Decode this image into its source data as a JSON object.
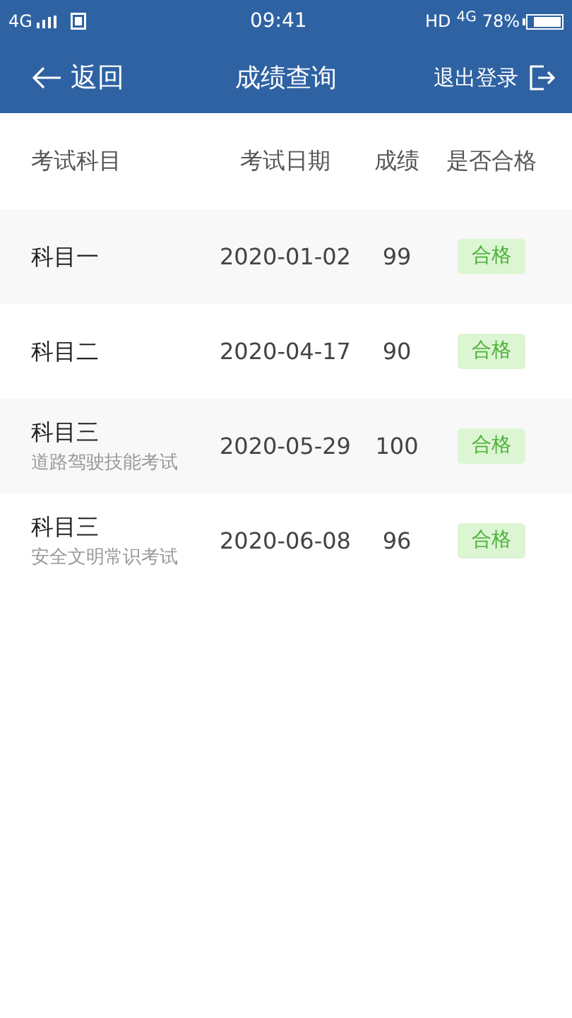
{
  "status_bar": {
    "network": "4G",
    "time": "09:41",
    "hd": "HD",
    "network_right": "4G",
    "battery": "78%"
  },
  "nav": {
    "back": "返回",
    "title": "成绩查询",
    "logout": "退出登录"
  },
  "table": {
    "columns": [
      "考试科目",
      "考试日期",
      "成绩",
      "是否合格"
    ],
    "rows": [
      {
        "subject": "科目一",
        "date": "2020-01-02",
        "score": "99",
        "result": "合格",
        "passed": true
      },
      {
        "subject": "科目二",
        "date": "2020-04-17",
        "score": "90",
        "result": "合格",
        "passed": true
      },
      {
        "subject": "科目三",
        "note": "道路驾驶技能考试",
        "date": "2020-05-29",
        "score": "100",
        "result": "合格",
        "passed": true
      },
      {
        "subject": "科目三",
        "note": "安全文明常识考试",
        "date": "2020-06-08",
        "score": "96",
        "result": "合格",
        "passed": true
      }
    ]
  }
}
